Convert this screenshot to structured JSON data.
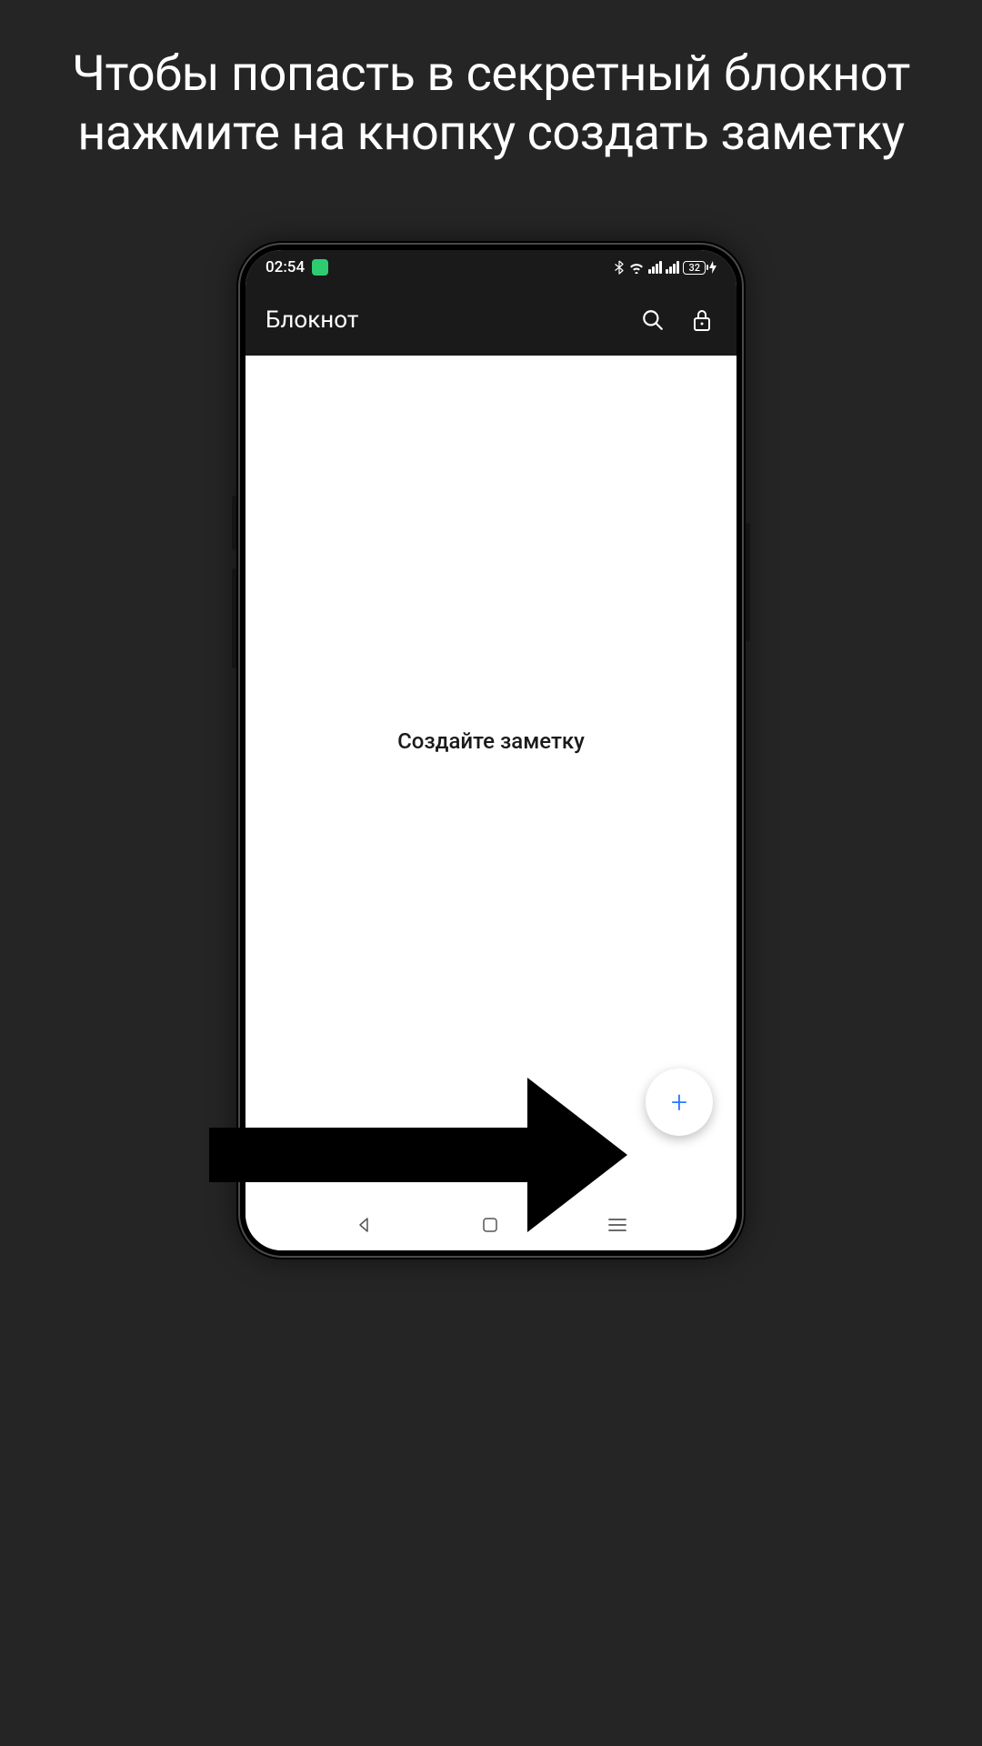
{
  "promo": {
    "text": "Чтобы попасть в секретный блокнот нажмите на кнопку создать заметку"
  },
  "statusBar": {
    "time": "02:54",
    "batteryLevel": "32"
  },
  "appBar": {
    "title": "Блокнот"
  },
  "content": {
    "emptyStateText": "Создайте заметку"
  },
  "fab": {
    "plusSymbol": "+"
  }
}
